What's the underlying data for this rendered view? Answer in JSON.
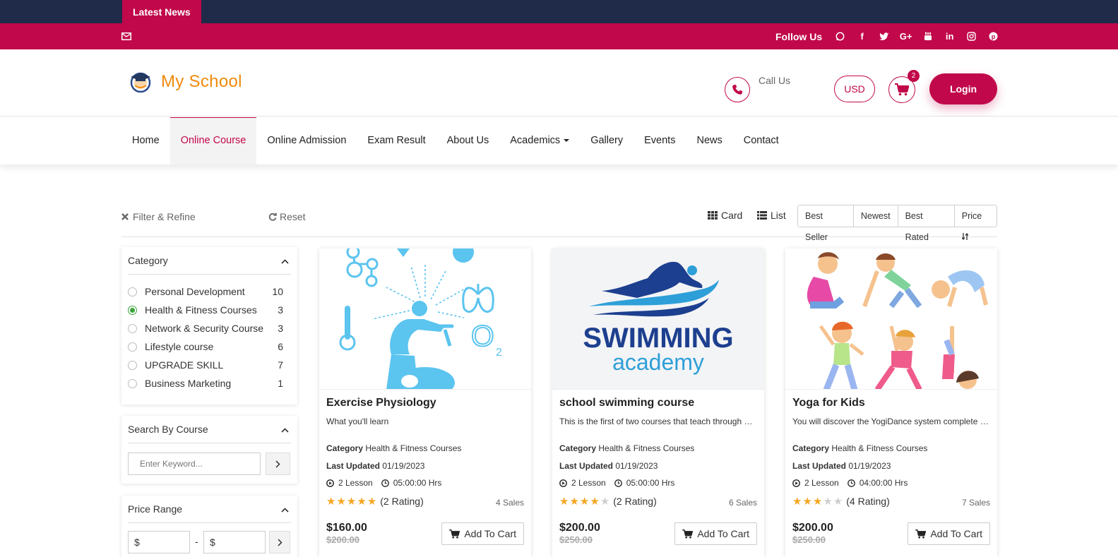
{
  "topbar": {
    "latest_news": "Latest News"
  },
  "social": {
    "follow_label": "Follow Us",
    "icons": [
      "whatsapp-icon",
      "facebook-icon",
      "twitter-icon",
      "google-plus-icon",
      "youtube-icon",
      "linkedin-icon",
      "instagram-icon",
      "pinterest-icon"
    ]
  },
  "header": {
    "logo_text": "My School",
    "call_label": "Call Us",
    "currency": "USD",
    "cart_count": "2",
    "login": "Login"
  },
  "nav": {
    "items": [
      "Home",
      "Online Course",
      "Online Admission",
      "Exam Result",
      "About Us",
      "Academics",
      "Gallery",
      "Events",
      "News",
      "Contact"
    ],
    "active": "Online Course"
  },
  "filter": {
    "filter_label": "Filter & Refine",
    "reset_label": "Reset",
    "card_label": "Card",
    "list_label": "List",
    "sort": [
      "Best Seller",
      "Newest",
      "Best Rated",
      "Price"
    ]
  },
  "category_panel": {
    "title": "Category",
    "items": [
      {
        "name": "Personal Development",
        "count": "10",
        "selected": false
      },
      {
        "name": "Health & Fitness Courses",
        "count": "3",
        "selected": true
      },
      {
        "name": "Network & Security Course",
        "count": "3",
        "selected": false
      },
      {
        "name": "Lifestyle course",
        "count": "6",
        "selected": false
      },
      {
        "name": "UPGRADE SKILL",
        "count": "7",
        "selected": false
      },
      {
        "name": "Business Marketing",
        "count": "1",
        "selected": false
      }
    ]
  },
  "search_panel": {
    "title": "Search By Course",
    "placeholder": "Enter Keyword..."
  },
  "price_panel": {
    "title": "Price Range",
    "min": "$",
    "max": "$",
    "dash": "-"
  },
  "labels": {
    "category": "Category",
    "last_updated": "Last Updated",
    "add_to_cart": "Add To Cart"
  },
  "courses": [
    {
      "title": "Exercise Physiology",
      "desc": "What you'll learn",
      "category": "Health & Fitness Courses",
      "updated": "01/19/2023",
      "lessons": "2 Lesson",
      "duration": "05:00:00 Hrs",
      "stars": 5,
      "rating": "(2 Rating)",
      "sales": "4 Sales",
      "price": "$160.00",
      "old_price": "$200.00"
    },
    {
      "title": "school swimming course",
      "desc": "This is the first of two courses that teach through …",
      "category": "Health & Fitness Courses",
      "updated": "01/19/2023",
      "lessons": "2 Lesson",
      "duration": "05:00:00 Hrs",
      "stars": 4,
      "rating": "(2 Rating)",
      "sales": "6 Sales",
      "price": "$200.00",
      "old_price": "$250.00",
      "image_text": [
        "SWIMMING",
        "academy"
      ]
    },
    {
      "title": "Yoga for Kids",
      "desc": "You will discover the YogiDance system complete …",
      "category": "Health & Fitness Courses",
      "updated": "01/19/2023",
      "lessons": "2 Lesson",
      "duration": "04:00:00 Hrs",
      "stars": 3,
      "rating": "(4 Rating)",
      "sales": "7 Sales",
      "price": "$200.00",
      "old_price": "$250.00"
    }
  ],
  "colors": {
    "brand": "#c1084a",
    "topbar": "#1f2b48",
    "logo": "#f08a0c",
    "star": "#f5a623",
    "illustration_blue": "#5bc4ef"
  }
}
